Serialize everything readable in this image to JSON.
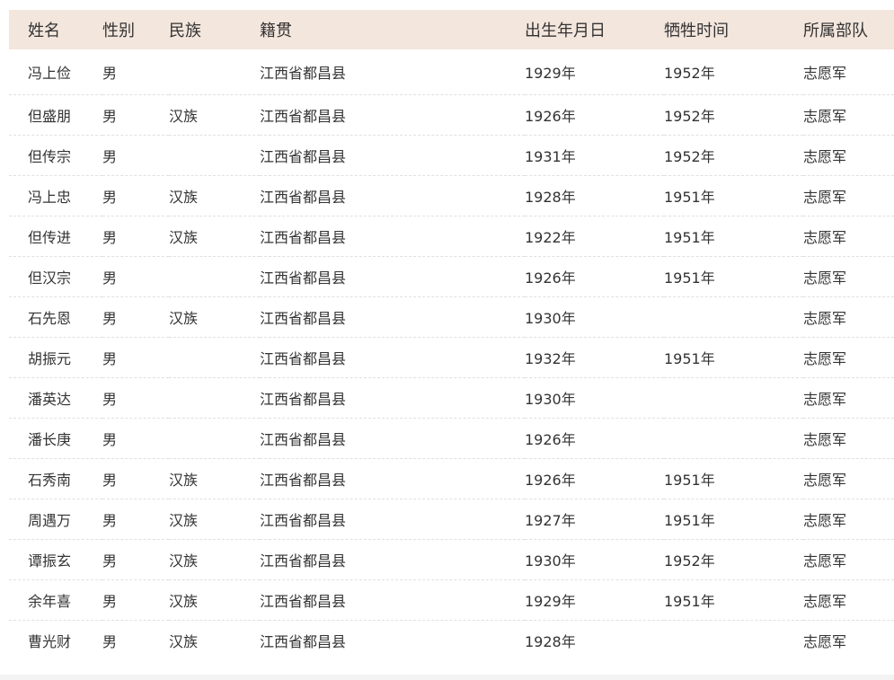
{
  "table": {
    "headers": [
      "姓名",
      "性别",
      "民族",
      "籍贯",
      "出生年月日",
      "牺牲时间",
      "所属部队"
    ],
    "rows": [
      [
        "冯上俭",
        "男",
        "",
        "江西省都昌县",
        "1929年",
        "1952年",
        "志愿军"
      ],
      [
        "但盛朋",
        "男",
        "汉族",
        "江西省都昌县",
        "1926年",
        "1952年",
        "志愿军"
      ],
      [
        "但传宗",
        "男",
        "",
        "江西省都昌县",
        "1931年",
        "1952年",
        "志愿军"
      ],
      [
        "冯上忠",
        "男",
        "汉族",
        "江西省都昌县",
        "1928年",
        "1951年",
        "志愿军"
      ],
      [
        "但传进",
        "男",
        "汉族",
        "江西省都昌县",
        "1922年",
        "1951年",
        "志愿军"
      ],
      [
        "但汉宗",
        "男",
        "",
        "江西省都昌县",
        "1926年",
        "1951年",
        "志愿军"
      ],
      [
        "石先恩",
        "男",
        "汉族",
        "江西省都昌县",
        "1930年",
        "",
        "志愿军"
      ],
      [
        "胡振元",
        "男",
        "",
        "江西省都昌县",
        "1932年",
        "1951年",
        "志愿军"
      ],
      [
        "潘英达",
        "男",
        "",
        "江西省都昌县",
        "1930年",
        "",
        "志愿军"
      ],
      [
        "潘长庚",
        "男",
        "",
        "江西省都昌县",
        "1926年",
        "",
        "志愿军"
      ],
      [
        "石秀南",
        "男",
        "汉族",
        "江西省都昌县",
        "1926年",
        "1951年",
        "志愿军"
      ],
      [
        "周遇万",
        "男",
        "汉族",
        "江西省都昌县",
        "1927年",
        "1951年",
        "志愿军"
      ],
      [
        "谭振玄",
        "男",
        "汉族",
        "江西省都昌县",
        "1930年",
        "1952年",
        "志愿军"
      ],
      [
        "余年喜",
        "男",
        "汉族",
        "江西省都昌县",
        "1929年",
        "1951年",
        "志愿军"
      ],
      [
        "曹光财",
        "男",
        "汉族",
        "江西省都昌县",
        "1928年",
        "",
        "志愿军"
      ]
    ]
  }
}
